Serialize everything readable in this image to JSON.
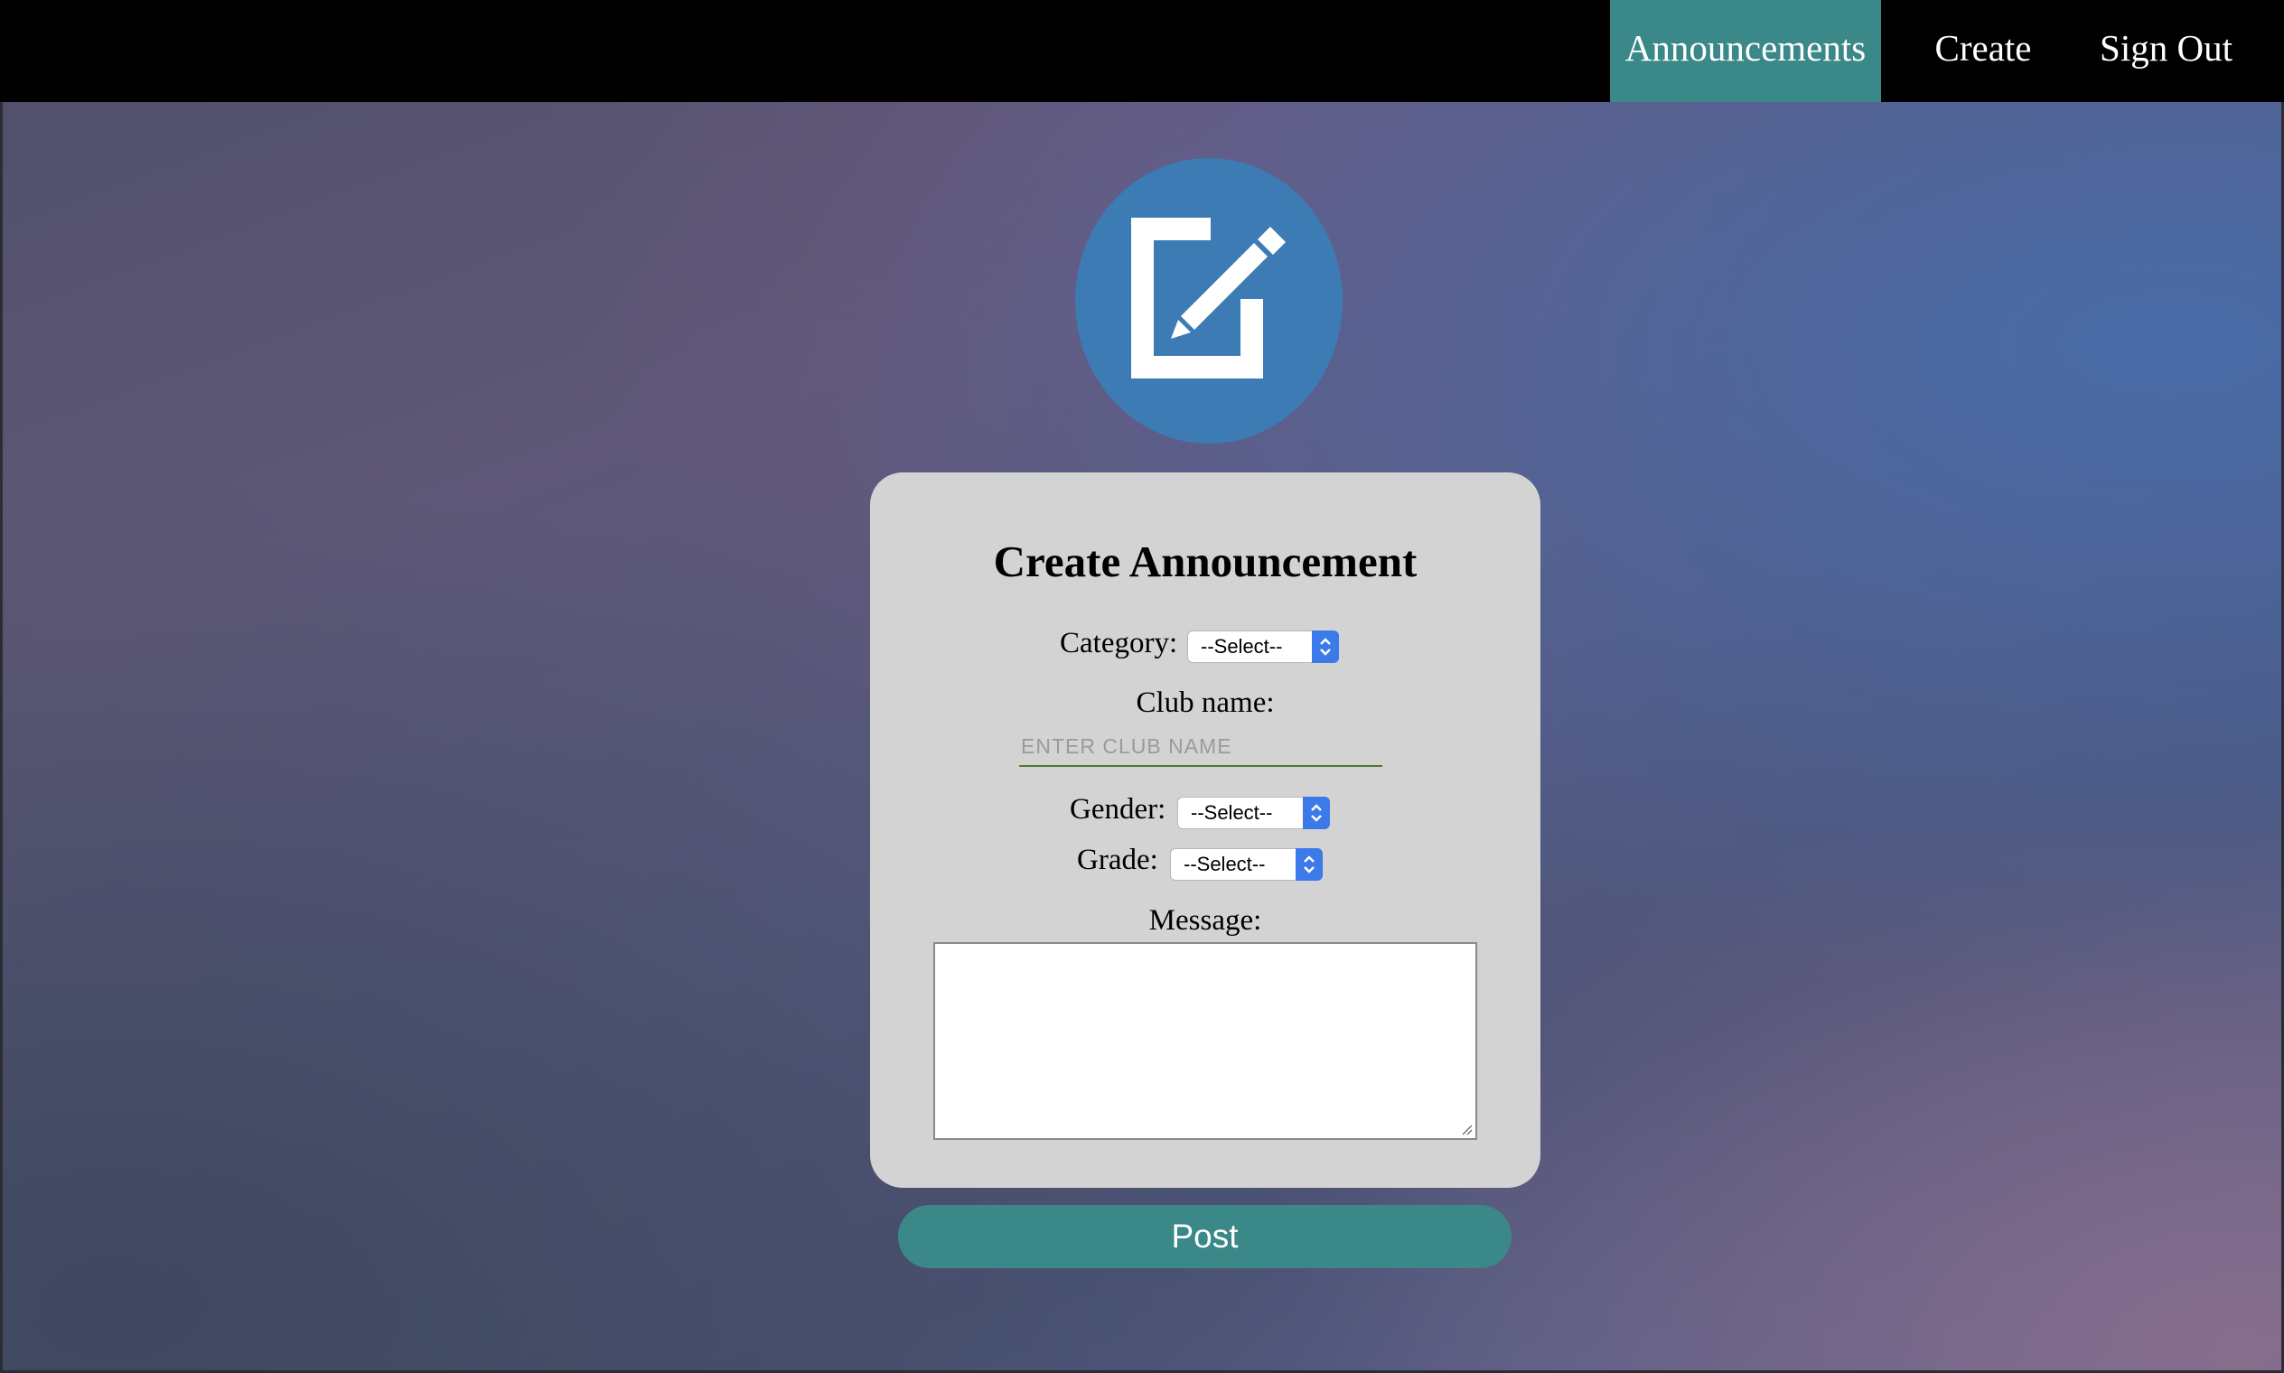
{
  "nav": {
    "items": [
      {
        "label": "Announcements",
        "active": true
      },
      {
        "label": "Create",
        "active": false
      },
      {
        "label": "Sign Out",
        "active": false
      }
    ]
  },
  "hero": {
    "icon": "edit-icon"
  },
  "form": {
    "title": "Create Announcement",
    "category": {
      "label": "Category:",
      "selected": "--Select--"
    },
    "club_name": {
      "label": "Club name:",
      "placeholder": "ENTER CLUB NAME",
      "value": ""
    },
    "gender": {
      "label": "Gender:",
      "selected": "--Select--"
    },
    "grade": {
      "label": "Grade:",
      "selected": "--Select--"
    },
    "message": {
      "label": "Message:",
      "value": ""
    },
    "post_label": "Post"
  },
  "colors": {
    "nav_bg": "#000000",
    "accent_teal": "#3b8888",
    "icon_blue": "#3d7bb4",
    "card_bg": "#d3d3d3",
    "select_arrow": "#3b7ae8"
  }
}
